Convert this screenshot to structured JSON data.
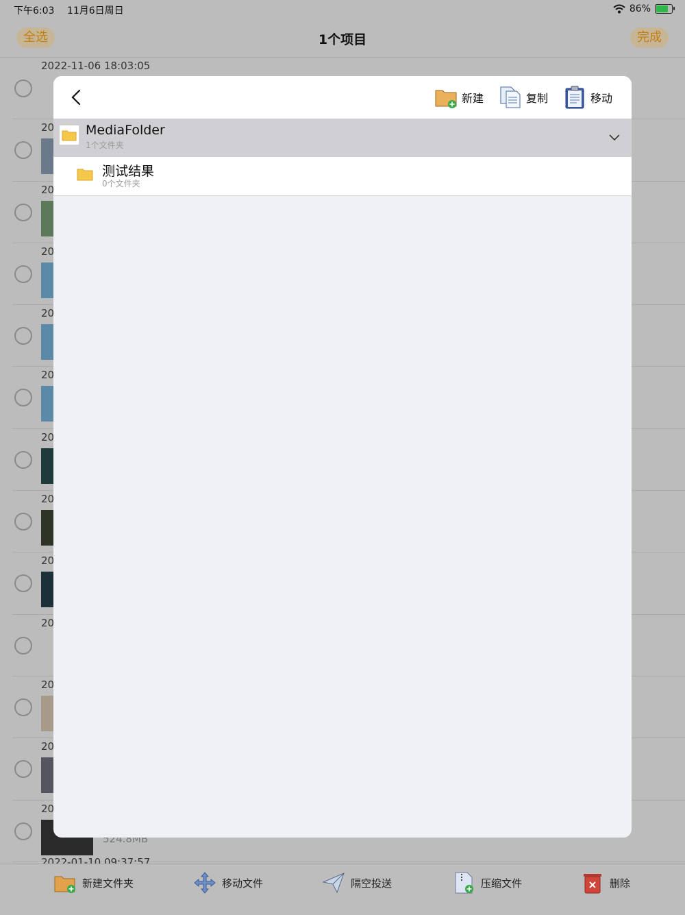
{
  "status_bar": {
    "time": "下午6:03",
    "date": "11月6日周日",
    "battery": "86%",
    "battery_level": 0.86
  },
  "nav": {
    "select_all": "全选",
    "title": "1个项目",
    "done": "完成"
  },
  "background_list": {
    "first_date": "2022-11-06 18:03:05",
    "row_prefix": "20",
    "last_size": "524.8MB",
    "bottom_date": "2022-01-10 09:37:57"
  },
  "modal": {
    "new_label": "新建",
    "copy_label": "复制",
    "move_label": "移动",
    "parent_folder": {
      "name": "MediaFolder",
      "meta": "1个文件夹"
    },
    "child_folder": {
      "name": "测试结果",
      "meta": "0个文件夹"
    }
  },
  "toolbar": {
    "new_folder": "新建文件夹",
    "move_files": "移动文件",
    "airdrop": "隔空投送",
    "compress": "压缩文件",
    "delete": "删除"
  },
  "colors": {
    "accent": "#c47f12",
    "folder_yellow": "#f5c84a",
    "dim_overlay": "#bcbcbc"
  }
}
